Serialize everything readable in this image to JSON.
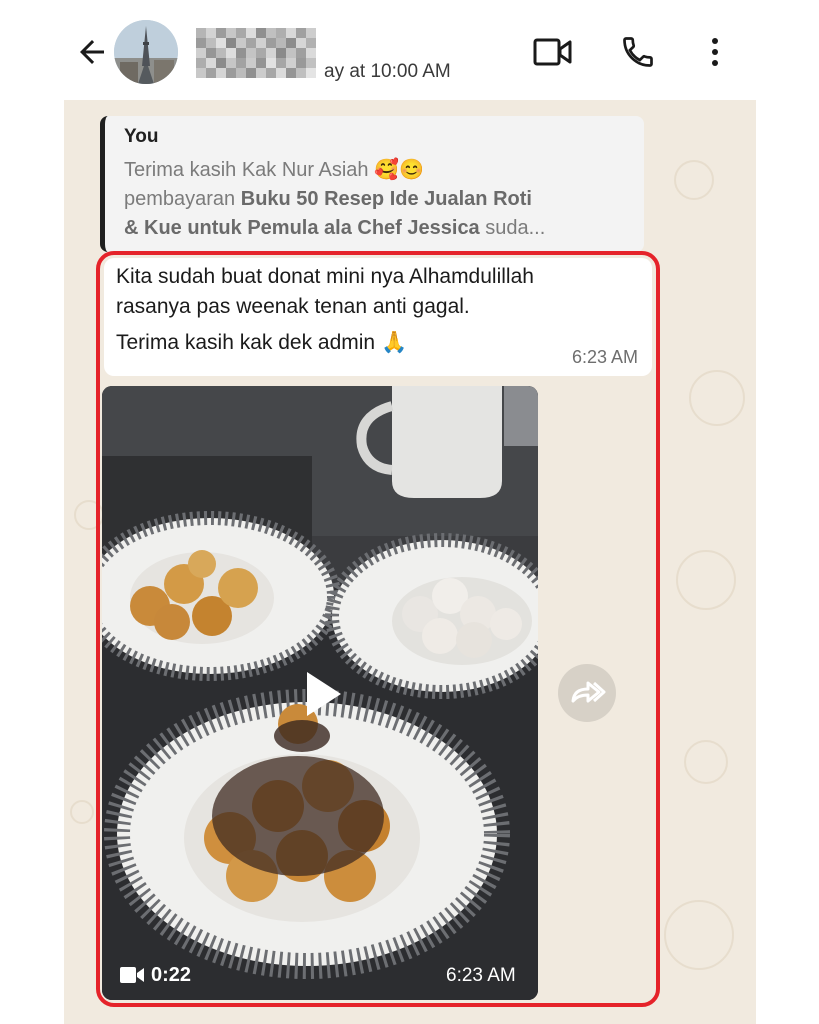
{
  "header": {
    "last_seen": "ay at 10:00 AM"
  },
  "quote": {
    "author": "You",
    "line1": "Terima kasih Kak Nur Asiah 🥰😊",
    "line2_plain": "pembayaran ",
    "line2_bold": "Buku 50 Resep Ide Jualan Roti",
    "line3_bold": "& Kue untuk Pemula ala Chef Jessica",
    "line3_plain": " suda..."
  },
  "message": {
    "line1": "Kita sudah buat donat mini nya Alhamdulillah",
    "line2": "rasanya pas weenak tenan anti gagal.",
    "line3": "Terima kasih kak dek admin 🙏",
    "time": "6:23 AM"
  },
  "video": {
    "duration": "0:22",
    "time": "6:23 AM"
  },
  "colors": {
    "highlight": "#e5232a",
    "chat_background": "#f1eadf",
    "quote_bar": "#1f1f1f"
  },
  "icons": [
    "back-arrow-icon",
    "video-call-icon",
    "phone-icon",
    "more-vert-icon",
    "play-icon",
    "video-camera-icon",
    "forward-icon"
  ]
}
